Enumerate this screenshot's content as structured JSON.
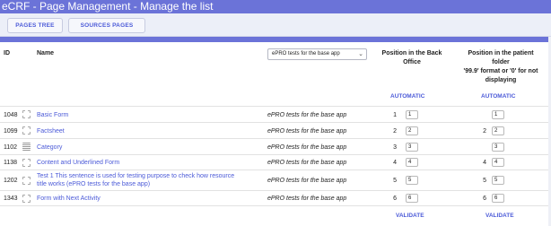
{
  "app": {
    "title": "eCRF - Page Management - Manage the list"
  },
  "toolbar": {
    "pages_tree": "PAGES TREE",
    "sources_pages": "SOURCES PAGES"
  },
  "table": {
    "headers": {
      "id": "ID",
      "name": "Name",
      "back_office_line1": "Position in the Back",
      "back_office_line2": "Office",
      "patient_folder_line1": "Position in the patient",
      "patient_folder_line2": "folder",
      "patient_folder_line3": "'99.9' format or '0' for not",
      "patient_folder_line4": "displaying"
    },
    "filter_select": {
      "value": "ePRO tests for the base app"
    },
    "automatic_back_office": "AUTOMATIC",
    "automatic_patient_folder": "AUTOMATIC",
    "rows": [
      {
        "id": "1048",
        "name": "Basic Form",
        "category": "ePRO tests for the base app",
        "bo_pos": "1",
        "bo_input": "1",
        "pf_pos": "",
        "pf_input": "1"
      },
      {
        "id": "1099",
        "name": "Factsheet",
        "category": "ePRO tests for the base app",
        "bo_pos": "2",
        "bo_input": "2",
        "pf_pos": "2",
        "pf_input": "2"
      },
      {
        "id": "1102",
        "name": "Category",
        "category": "ePRO tests for the base app",
        "bo_pos": "3",
        "bo_input": "3",
        "pf_pos": "",
        "pf_input": "3"
      },
      {
        "id": "1138",
        "name": "Content and Underlined Form",
        "category": "ePRO tests for the base app",
        "bo_pos": "4",
        "bo_input": "4",
        "pf_pos": "4",
        "pf_input": "4"
      },
      {
        "id": "1202",
        "name_line1": "Test 1 This sentence is used for testing purpose to check how resource",
        "name_line2": "title works (ePRO tests for the base app)",
        "category": "ePRO tests for the base app",
        "bo_pos": "5",
        "bo_input": "5",
        "pf_pos": "5",
        "pf_input": "5"
      },
      {
        "id": "1343",
        "name": "Form with Next Activity",
        "category": "ePRO tests for the base app",
        "bo_pos": "6",
        "bo_input": "6",
        "pf_pos": "6",
        "pf_input": "6"
      }
    ],
    "validate_back_office": "VALIDATE",
    "validate_patient_folder": "VALIDATE"
  },
  "icons": [
    "page-icon",
    "list-page-icon",
    "chevron-down-icon"
  ],
  "colors": {
    "accent": "#6b73d8",
    "link": "#4b5ad8"
  }
}
